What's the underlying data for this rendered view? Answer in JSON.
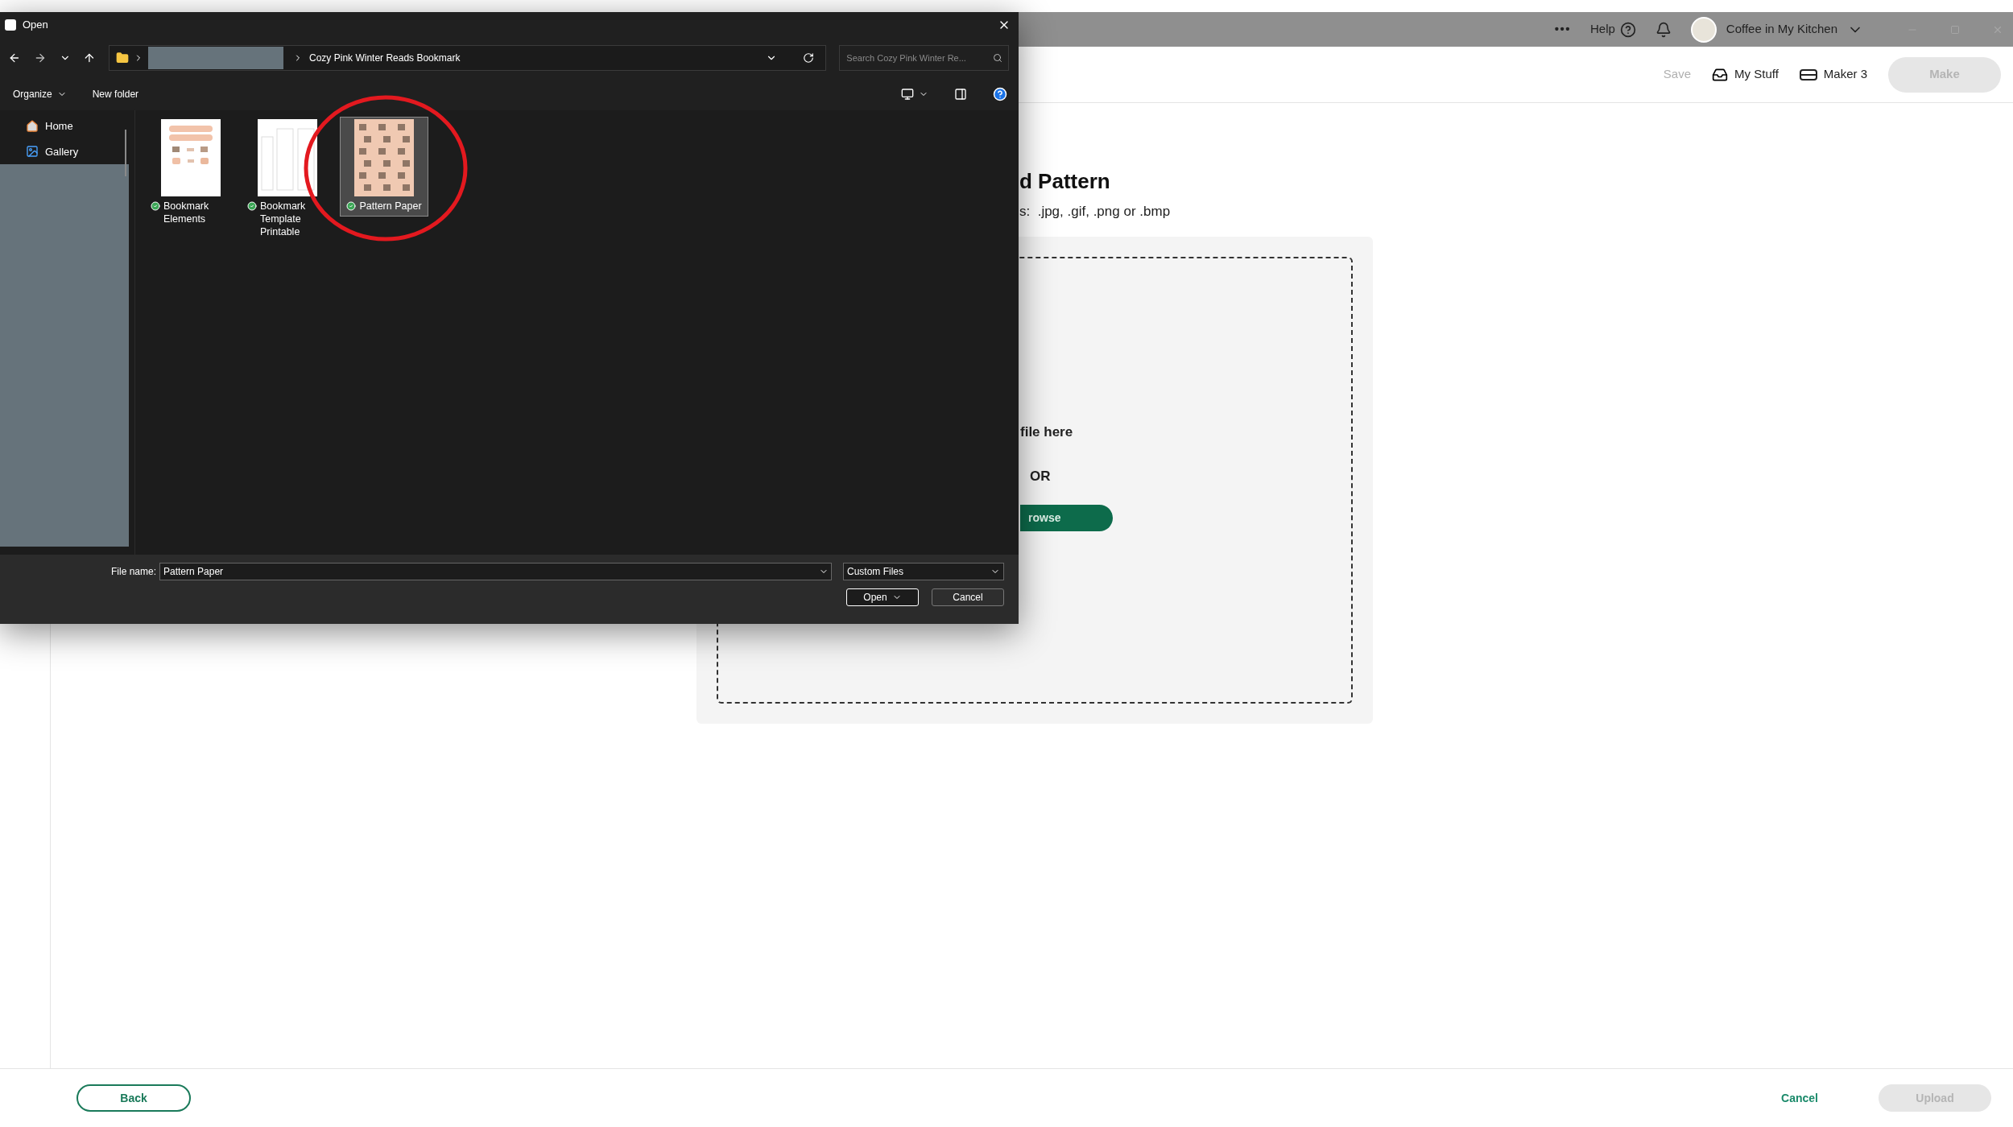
{
  "app_header": {
    "menu": "•••",
    "help": "Help",
    "account": "Coffee in My Kitchen"
  },
  "toolbar": {
    "save": {
      "label": "Save",
      "disabled": true
    },
    "my_stuff": "My Stuff",
    "machine": "Maker 3",
    "make": {
      "label": "Make",
      "disabled": true
    }
  },
  "page": {
    "title": "d Pattern",
    "formats": "s:  .jpg, .gif, .png or .bmp",
    "drop_hint": "file here",
    "or": "OR",
    "browse": "rowse"
  },
  "footer": {
    "back": "Back",
    "cancel": "Cancel",
    "upload": {
      "label": "Upload",
      "disabled": true
    }
  },
  "dialog": {
    "title": "Open",
    "path": [
      "Cozy Pink Winter Reads Bookmark"
    ],
    "search": {
      "placeholder": "Search Cozy Pink Winter Re..."
    },
    "commands": [
      "Organize",
      "New folder"
    ],
    "nav": [
      {
        "label": "Home",
        "kind": "home"
      },
      {
        "label": "Gallery",
        "kind": "gallery"
      }
    ],
    "files": [
      {
        "name": "Bookmark Elements",
        "kind": "sheet",
        "selected": false
      },
      {
        "name": "Bookmark Template Printable",
        "kind": "template",
        "selected": false
      },
      {
        "name": "Pattern Paper",
        "kind": "pattern",
        "selected": true
      }
    ],
    "file_name": {
      "label": "File name:",
      "value": "Pattern Paper"
    },
    "file_type": "Custom Files",
    "buttons": [
      "Open",
      "Cancel"
    ]
  }
}
